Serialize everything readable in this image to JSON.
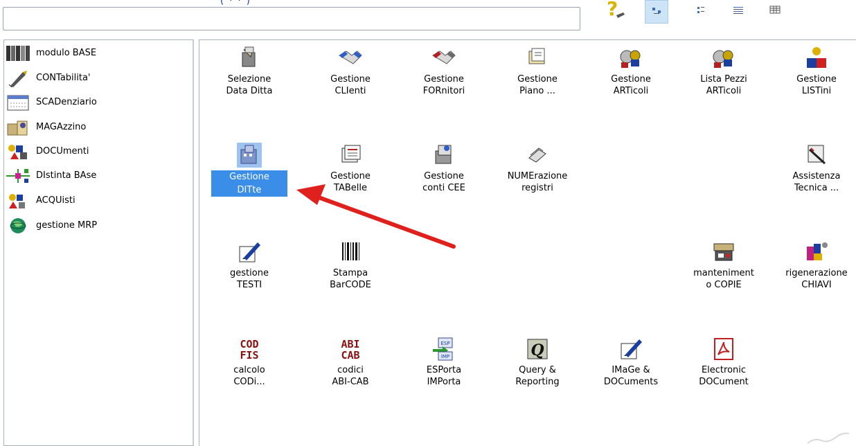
{
  "top": {
    "partial_glyphs": "( · · )",
    "search_value": "",
    "view_buttons": [
      {
        "icon": "large-icons-view-icon"
      },
      {
        "icon": "small-icons-view-icon"
      },
      {
        "icon": "list-view-icon"
      },
      {
        "icon": "details-view-icon"
      }
    ],
    "help_icon": "help-pointer-icon"
  },
  "sidebar": {
    "items": [
      {
        "label": "modulo BASE",
        "icon": "books-icon"
      },
      {
        "label": "CONTabilita'",
        "icon": "pen-nib-icon"
      },
      {
        "label": "SCADenziario",
        "icon": "calendar-icon"
      },
      {
        "label": "MAGAzzino",
        "icon": "warehouse-icon"
      },
      {
        "label": "DOCUmenti",
        "icon": "shapes-documents-icon"
      },
      {
        "label": "DIstinta BAse",
        "icon": "tree-nodes-icon"
      },
      {
        "label": "ACQUisti",
        "icon": "purchases-icon"
      },
      {
        "label": "gestione MRP",
        "icon": "globe-icon"
      }
    ]
  },
  "tiles": [
    {
      "line1": "Selezione",
      "line2": "Data Ditta",
      "icon": "hand-select-icon"
    },
    {
      "line1": "Gestione",
      "line2": "CLIenti",
      "icon": "handshake-blue-icon"
    },
    {
      "line1": "Gestione",
      "line2": "FORnitori",
      "icon": "handshake-red-icon"
    },
    {
      "line1": "Gestione",
      "line2": "Piano ...",
      "icon": "folder-tree-icon"
    },
    {
      "line1": "Gestione",
      "line2": "ARTicoli",
      "icon": "gears-icon"
    },
    {
      "line1": "Lista Pezzi",
      "line2": "ARTicoli",
      "icon": "gears-list-icon"
    },
    {
      "line1": "Gestione",
      "line2": "LISTini",
      "icon": "blocks-icon"
    },
    {
      "line1": "Gestione",
      "line2": "DITte",
      "icon": "companies-icon"
    },
    {
      "line1": "Gestione",
      "line2": "TABelle",
      "icon": "tables-icon"
    },
    {
      "line1": "Gestione",
      "line2": "conti CEE",
      "icon": "ledger-icon"
    },
    {
      "line1": "NUMErazione",
      "line2": "registri",
      "icon": "numbering-icon"
    },
    {
      "line1": "Assistenza",
      "line2": "Tecnica ...",
      "icon": "support-icon"
    },
    {
      "line1": "gestione",
      "line2": "TESTI",
      "icon": "pen-paper-icon"
    },
    {
      "line1": "Stampa",
      "line2": "BarCODE",
      "icon": "barcode-icon"
    },
    {
      "line1": "manteniment",
      "line2": "o COPIE",
      "icon": "copy-maintenance-icon"
    },
    {
      "line1": "rigenerazione",
      "line2": "CHIAVI",
      "icon": "keys-icon"
    },
    {
      "line1": "calcolo",
      "line2": "CODi...",
      "icon": "codfis-icon",
      "icon_text": [
        "COD",
        "FIS"
      ]
    },
    {
      "line1": "codici",
      "line2": "ABI-CAB",
      "icon": "abicab-icon",
      "icon_text": [
        "ABI",
        "CAB"
      ]
    },
    {
      "line1": "ESPorta",
      "line2": "IMPorta",
      "icon": "export-import-icon",
      "icon_text": [
        "ESP",
        "IMP"
      ]
    },
    {
      "line1": "Query &",
      "line2": "Reporting",
      "icon": "query-icon",
      "icon_text": [
        "Q"
      ]
    },
    {
      "line1": "IMaGe &",
      "line2": "DOCuments",
      "icon": "image-docs-icon"
    },
    {
      "line1": "Electronic",
      "line2": "DOCument",
      "icon": "pdf-icon"
    }
  ],
  "selected_tile": "Gestione DITte",
  "colors": {
    "accent": "#3b8ee8",
    "arrow": "#e0201c",
    "border": "#a9b3bd"
  }
}
